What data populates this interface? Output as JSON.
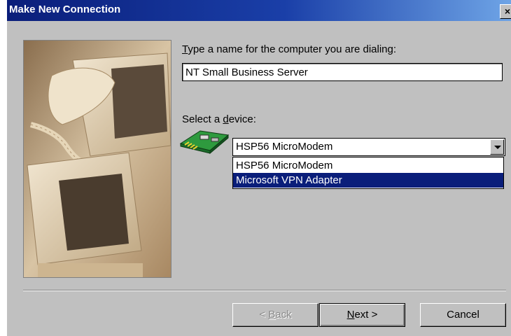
{
  "window": {
    "title": "Make New Connection",
    "close_glyph": "×"
  },
  "form": {
    "name_label_accel": "T",
    "name_label_rest": "ype a name for the computer you are dialing:",
    "name_value": "NT Small Business Server",
    "device_label_pre": "Select a ",
    "device_label_accel": "d",
    "device_label_rest": "evice:",
    "device_selected": "HSP56 MicroModem",
    "device_options": [
      "HSP56 MicroModem",
      "Microsoft VPN Adapter"
    ],
    "highlighted_option": "Microsoft VPN Adapter"
  },
  "buttons": {
    "back_pre": "< ",
    "back_accel": "B",
    "back_rest": "ack",
    "next_accel": "N",
    "next_rest": "ext >",
    "cancel": "Cancel"
  },
  "icons": {
    "device_icon": "modem-icon",
    "side_image": "computers-illustration"
  },
  "colors": {
    "titlebar_dark": "#0a1e7a",
    "titlebar_light": "#6ea4e6",
    "dialog_face": "#c0c0c0",
    "selection": "#0a1e7a"
  }
}
